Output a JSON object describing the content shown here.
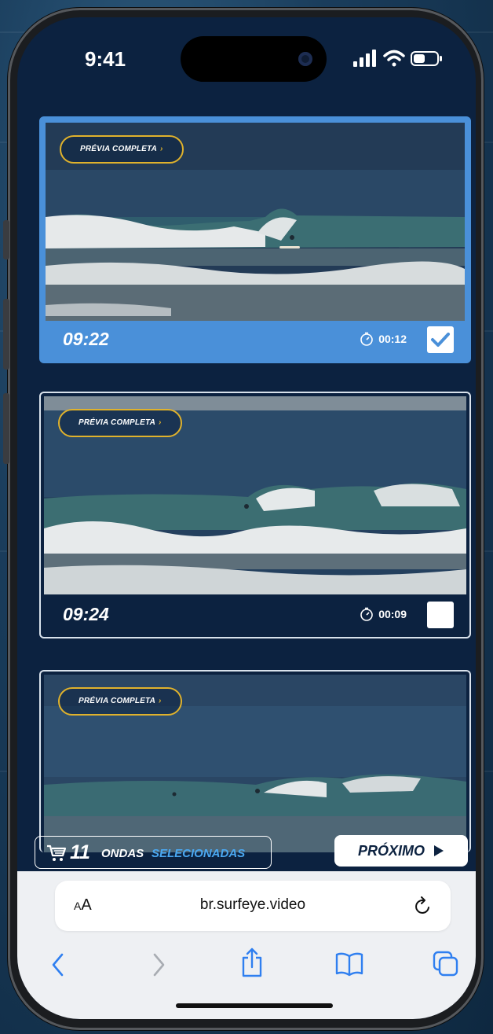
{
  "status_bar": {
    "time": "9:41"
  },
  "cards": [
    {
      "preview_label": "PRÉVIA COMPLETA",
      "time": "09:22",
      "duration": "00:12",
      "selected": true
    },
    {
      "preview_label": "PRÉVIA COMPLETA",
      "time": "09:24",
      "duration": "00:09",
      "selected": false
    },
    {
      "preview_label": "PRÉVIA COMPLETA",
      "time": "",
      "duration": "",
      "selected": false
    }
  ],
  "cart": {
    "count": "11",
    "label_word": "ONDAS",
    "label_selected": "SELECIONADAS"
  },
  "next_button": {
    "label": "PRÓXIMO"
  },
  "browser": {
    "font_size_label": "AA",
    "url": "br.surfeye.video"
  },
  "colors": {
    "accent": "#4a90d9",
    "navy": "#0c2240",
    "gold": "#e0b22c",
    "highlight": "#4aa7f0"
  },
  "icons": {
    "cart": "cart-icon",
    "play": "play-triangle-icon",
    "stopwatch": "stopwatch-icon",
    "check": "checkmark-icon",
    "reload": "reload-icon",
    "back": "chevron-left-icon",
    "forward": "chevron-right-icon",
    "share": "share-icon",
    "bookmarks": "book-icon",
    "tabs": "tabs-icon"
  }
}
